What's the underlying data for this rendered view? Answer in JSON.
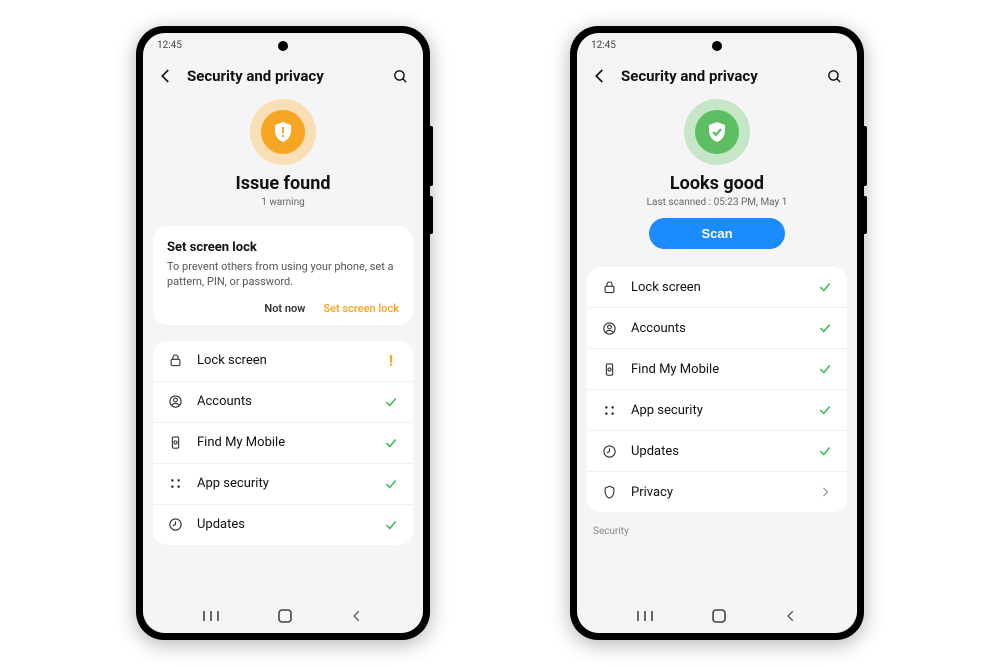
{
  "phones": [
    {
      "status_time": "12:45",
      "page_title": "Security and privacy",
      "hero": {
        "state": "warn",
        "title": "Issue found",
        "subtitle": "1 warning"
      },
      "prompt_card": {
        "title": "Set screen lock",
        "body": "To prevent others from using your phone, set a pattern, PIN, or password.",
        "not_now_label": "Not now",
        "action_label": "Set screen lock"
      },
      "rows": [
        {
          "icon": "lock",
          "label": "Lock screen",
          "status": "warn"
        },
        {
          "icon": "account",
          "label": "Accounts",
          "status": "ok"
        },
        {
          "icon": "find",
          "label": "Find My Mobile",
          "status": "ok"
        },
        {
          "icon": "apps",
          "label": "App security",
          "status": "ok"
        },
        {
          "icon": "update",
          "label": "Updates",
          "status": "ok"
        }
      ]
    },
    {
      "status_time": "12:45",
      "page_title": "Security and privacy",
      "hero": {
        "state": "ok",
        "title": "Looks good",
        "subtitle": "Last scanned : 05:23 PM, May 1",
        "scan_label": "Scan"
      },
      "rows": [
        {
          "icon": "lock",
          "label": "Lock screen",
          "status": "ok"
        },
        {
          "icon": "account",
          "label": "Accounts",
          "status": "ok"
        },
        {
          "icon": "find",
          "label": "Find My Mobile",
          "status": "ok"
        },
        {
          "icon": "apps",
          "label": "App security",
          "status": "ok"
        },
        {
          "icon": "update",
          "label": "Updates",
          "status": "ok"
        },
        {
          "icon": "privacy",
          "label": "Privacy",
          "status": "more"
        }
      ],
      "section_label": "Security"
    }
  ]
}
